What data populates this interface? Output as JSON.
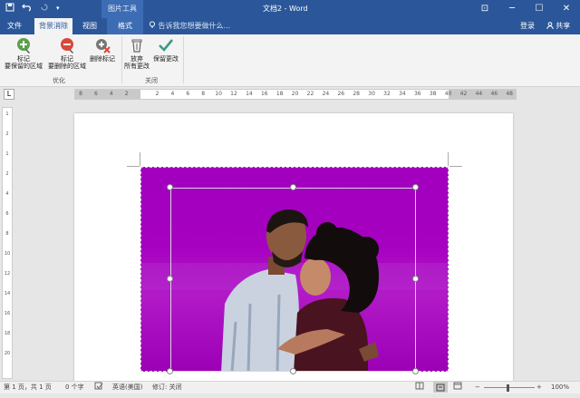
{
  "titlebar": {
    "context_group": "图片工具",
    "doc_title": "文档2 - Word",
    "restore_glyph": "⊡",
    "minimize_glyph": "─",
    "maximize_glyph": "☐",
    "close_glyph": "✕"
  },
  "tabs": {
    "file": "文件",
    "bg_removal": "背景消除",
    "view": "视图",
    "format": "格式"
  },
  "tellme": {
    "text": "告诉我您想要做什么..."
  },
  "account": {
    "login": "登录",
    "share": "共享"
  },
  "ribbon": {
    "mark_keep_1": "标记",
    "mark_keep_2": "要保留的区域",
    "mark_remove_1": "标记",
    "mark_remove_2": "要删除的区域",
    "delete_mark": "删除标记",
    "discard_1": "放弃",
    "discard_2": "所有更改",
    "keep_changes": "保留更改",
    "group_optimize": "优化",
    "group_close": "关闭"
  },
  "ruler": {
    "tabstop": "L",
    "ticks": [
      "8",
      "6",
      "4",
      "2",
      "",
      "2",
      "4",
      "6",
      "8",
      "10",
      "12",
      "14",
      "16",
      "18",
      "20",
      "22",
      "24",
      "26",
      "28",
      "30",
      "32",
      "34",
      "36",
      "38",
      "40",
      "42",
      "44",
      "46",
      "48"
    ]
  },
  "vruler": {
    "ticks": [
      "1",
      "2",
      "1",
      "2",
      "4",
      "6",
      "8",
      "10",
      "12",
      "14",
      "16",
      "18",
      "20"
    ]
  },
  "status": {
    "page": "第 1 页，共 1 页",
    "words": "0 个字",
    "lang": "英语(美国)",
    "track": "修订: 关闭",
    "zoom_minus": "−",
    "zoom_plus": "+",
    "zoom": "100%"
  }
}
